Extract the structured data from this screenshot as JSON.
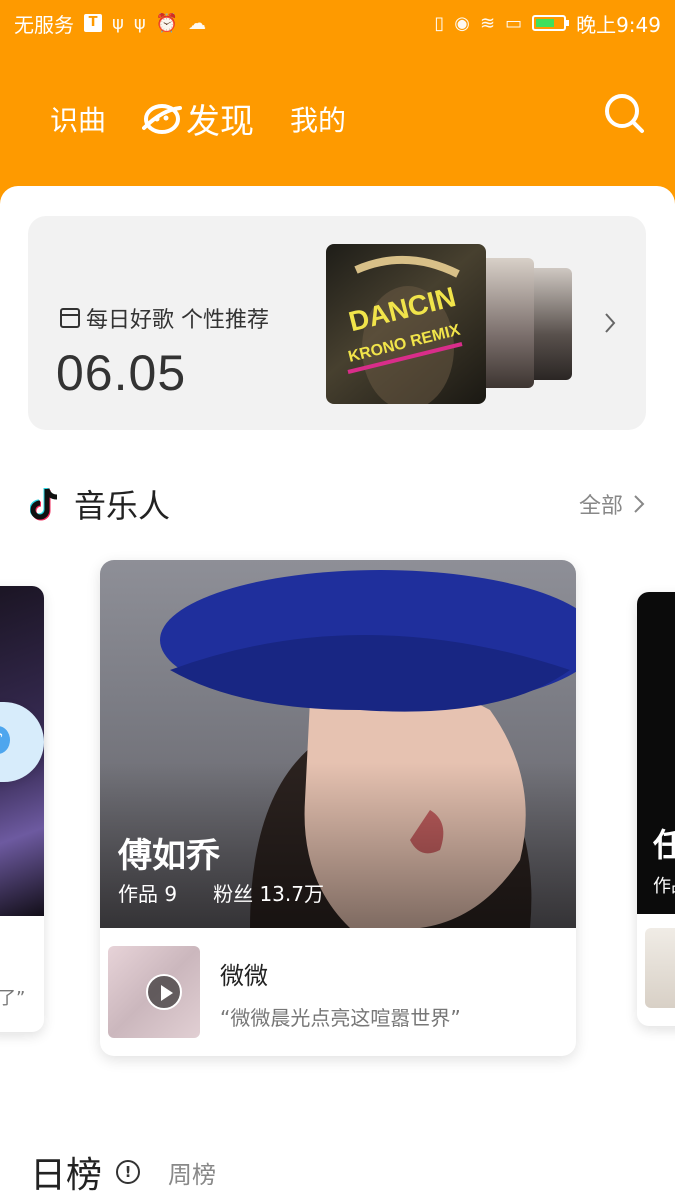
{
  "status_bar": {
    "carrier": "无服务",
    "time": "晚上9:49"
  },
  "nav": {
    "tabs": [
      {
        "label": "识曲"
      },
      {
        "label": "发现"
      },
      {
        "label": "我的"
      }
    ],
    "active_tab": "发现"
  },
  "daily": {
    "label": "每日好歌 个性推荐",
    "date": "06.05",
    "cover_text_1": "DANCIN",
    "cover_text_2": "KRONO REMIX"
  },
  "musicians": {
    "title": "音乐人",
    "all_label": "全部",
    "featured": {
      "name": "傅如乔",
      "works": "作品 9",
      "fans": "粉丝 13.7万",
      "song_title": "微微",
      "song_quote": "“微微晨光点亮这喧嚣世界”"
    },
    "left_partial_quote": "放了”",
    "right_partial_name": "任",
    "right_partial_stat": "作品"
  },
  "charts": {
    "title": "日榜",
    "tab": "周榜"
  },
  "colors": {
    "accent": "#fe9a00",
    "background": "#ffffff"
  }
}
